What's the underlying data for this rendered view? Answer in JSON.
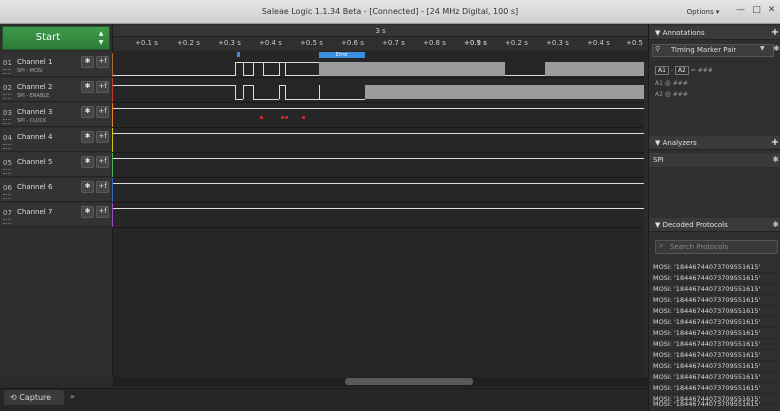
{
  "window": {
    "title": "Saleae Logic 1.1.34 Beta - [Connected] - [24 MHz Digital, 100 s]",
    "options_label": "Options ▾",
    "min": "—",
    "max": "□",
    "close": "✕"
  },
  "start": {
    "label": "Start",
    "up": "▲",
    "down": "▼"
  },
  "channels": [
    {
      "num": "01",
      "name": "Channel 1",
      "sub": "SPI - MOSI",
      "color": "#a06a30"
    },
    {
      "num": "02",
      "name": "Channel 2",
      "sub": "SPI - ENABLE",
      "color": "#c0392b"
    },
    {
      "num": "03",
      "name": "Channel 3",
      "sub": "SPI - CLOCK",
      "color": "#e67e22"
    },
    {
      "num": "04",
      "name": "Channel 4",
      "sub": "",
      "color": "#d4c120"
    },
    {
      "num": "05",
      "name": "Channel 5",
      "sub": "",
      "color": "#4caf50"
    },
    {
      "num": "06",
      "name": "Channel 6",
      "sub": "",
      "color": "#3466c2"
    },
    {
      "num": "07",
      "name": "Channel 7",
      "sub": "",
      "color": "#9b4dc0"
    }
  ],
  "channel_buttons": {
    "gear": "✱",
    "plus": "+f"
  },
  "timeline": {
    "top_label": "3 s",
    "ticks": [
      "+0.1 s",
      "+0.2 s",
      "+0.3 s",
      "+0.4 s",
      "+0.5 s",
      "+0.6 s",
      "+0.7 s",
      "+0.8 s",
      "+0.9 s",
      "+0.1 s",
      "+0.2 s",
      "+0.3 s",
      "+0.4 s",
      "+0.5"
    ],
    "error_label": "Error"
  },
  "bottom": {
    "capture": "Capture",
    "expand": "»"
  },
  "annotations": {
    "header": "Annotations",
    "plus": "+",
    "timing_pair": "Timing Marker Pair",
    "row1_a1": "A1",
    "row1_dash": "-",
    "row1_a2": "A2",
    "row1_val": "= ###",
    "row2_label": "A1",
    "row2_at": "@",
    "row2_val": "###",
    "row3_label": "A2",
    "row3_at": "@",
    "row3_val": "###"
  },
  "analyzers": {
    "header": "Analyzers",
    "plus": "+",
    "item": "SPI"
  },
  "decoded": {
    "header": "Decoded Protocols",
    "search_placeholder": "Search Protocols",
    "rows": [
      "MOSI: '18446744073709551615'",
      "MOSI: '18446744073709551615'",
      "MOSI: '18446744073709551615'",
      "MOSI: '18446744073709551615'",
      "MOSI: '18446744073709551615'",
      "MOSI: '18446744073709551615'",
      "MOSI: '18446744073709551615'",
      "MOSI: '18446744073709551615'",
      "MOSI: '18446744073709551615'",
      "MOSI: '18446744073709551615'",
      "MOSI: '18446744073709551615'",
      "MOSI: '18446744073709551615'",
      "MOSI: '18446744073709551615'",
      "MOSI: '18446744073709551615'"
    ]
  }
}
